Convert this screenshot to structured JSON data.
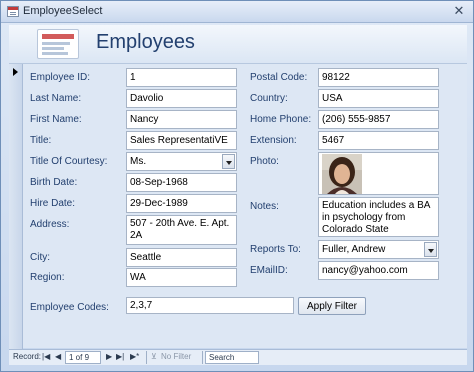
{
  "window": {
    "title": "EmployeeSelect",
    "close_glyph": "✕"
  },
  "header": {
    "title": "Employees",
    "icon": "form-icon"
  },
  "fields": {
    "employee_id": {
      "label": "Employee ID:",
      "value": "1"
    },
    "last_name": {
      "label": "Last Name:",
      "value": "Davolio"
    },
    "first_name": {
      "label": "First Name:",
      "value": "Nancy"
    },
    "title": {
      "label": "Title:",
      "value": "Sales RepresentatiVE"
    },
    "title_of_courtesy": {
      "label": "Title Of Courtesy:",
      "value": "Ms."
    },
    "birth_date": {
      "label": "Birth Date:",
      "value": "08-Sep-1968"
    },
    "hire_date": {
      "label": "Hire Date:",
      "value": "29-Dec-1989"
    },
    "address": {
      "label": "Address:",
      "value": "507 - 20th Ave. E. Apt. 2A"
    },
    "city": {
      "label": "City:",
      "value": "Seattle"
    },
    "region": {
      "label": "Region:",
      "value": "WA"
    },
    "postal_code": {
      "label": "Postal Code:",
      "value": "98122"
    },
    "country": {
      "label": "Country:",
      "value": "USA"
    },
    "home_phone": {
      "label": "Home Phone:",
      "value": "(206) 555-9857"
    },
    "extension": {
      "label": "Extension:",
      "value": "5467"
    },
    "photo": {
      "label": "Photo:"
    },
    "notes": {
      "label": "Notes:",
      "value": "Education includes a BA in psychology from Colorado State"
    },
    "reports_to": {
      "label": "Reports To:",
      "value": "Fuller, Andrew"
    },
    "email": {
      "label": "EMailID:",
      "value": "nancy@yahoo.com"
    }
  },
  "filter": {
    "label": "Employee Codes:",
    "value": "2,3,7",
    "button": "Apply Filter"
  },
  "navigation": {
    "record_label": "Record:",
    "first": "|◀",
    "prev": "◀",
    "position": "1 of 9",
    "next": "▶",
    "last": "▶|",
    "new": "▶*",
    "filter_status": "No Filter",
    "search_placeholder": "Search"
  }
}
